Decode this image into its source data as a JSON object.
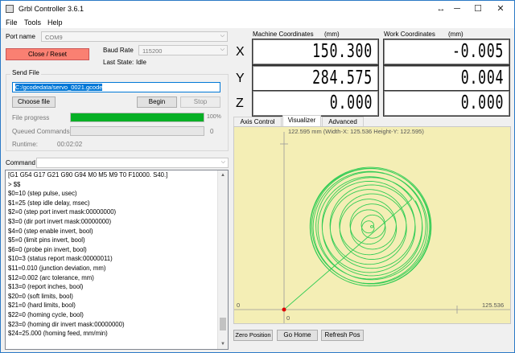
{
  "window": {
    "title": "Grbl Controller 3.6.1",
    "resize_glyph": "↔",
    "minimize_glyph": "─",
    "maximize_glyph": "☐",
    "close_glyph": "✕"
  },
  "menu": {
    "file": "File",
    "tools": "Tools",
    "help": "Help"
  },
  "connection": {
    "port_label": "Port name",
    "port_value": "COM9",
    "baud_label": "Baud Rate",
    "baud_value": "115200",
    "close_reset_label": "Close / Reset",
    "last_state_label": "Last State:",
    "last_state_value": "Idle"
  },
  "send_file": {
    "group_label": "Send File",
    "file_path": "C:/gcodedata/servo_0021.gcode",
    "choose_file_label": "Choose file",
    "begin_label": "Begin",
    "stop_label": "Stop",
    "progress_label": "File progress",
    "progress_fraction": 1.0,
    "progress_text": "100%",
    "queued_label": "Queued Commands",
    "queued_value": "0",
    "runtime_label": "Runtime:",
    "runtime_value": "00:02:02"
  },
  "command": {
    "label": "Command",
    "value": ""
  },
  "console": {
    "lines": [
      "[G1 G54 G17 G21 G90 G94 M0 M5 M9 T0 F10000. S40.]",
      "> $$",
      "$0=10 (step pulse, usec)",
      "$1=25 (step idle delay, msec)",
      "$2=0 (step port invert mask:00000000)",
      "$3=0 (dir port invert mask:00000000)",
      "$4=0 (step enable invert, bool)",
      "$5=0 (limit pins invert, bool)",
      "$6=0 (probe pin invert, bool)",
      "$10=3 (status report mask:00000011)",
      "$11=0.010 (junction deviation, mm)",
      "$12=0.002 (arc tolerance, mm)",
      "$13=0 (report inches, bool)",
      "$20=0 (soft limits, bool)",
      "$21=0 (hard limits, bool)",
      "$22=0 (homing cycle, bool)",
      "$23=0 (homing dir invert mask:00000000)",
      "$24=25.000 (homing feed, mm/min)"
    ],
    "scroll_fraction": 0.93
  },
  "coordinates": {
    "machine_label": "Machine Coordinates",
    "work_label": "Work Coordinates",
    "unit_label": "(mm)",
    "axes": [
      {
        "axis": "X",
        "machine": "150.300",
        "work": "-0.005"
      },
      {
        "axis": "Y",
        "machine": "284.575",
        "work": "0.004"
      },
      {
        "axis": "Z",
        "machine": "0.000",
        "work": "0.000"
      }
    ]
  },
  "tabs": {
    "axis_control": "Axis Control",
    "visualizer": "Visualizer",
    "advanced": "Advanced"
  },
  "visualizer": {
    "header_text": "122.595 mm  (Width-X: 125.536  Height-Y: 122.595)",
    "origin_label": "0",
    "x_end_label": "125.536",
    "y_zero_label": "0",
    "width_mm": 125.536,
    "height_mm": 122.595,
    "line_color": "#33cc55",
    "bg_color": "#f4eeb5",
    "tool_color": "#dd0000"
  },
  "bottom_buttons": {
    "zero_position": "Zero Position",
    "go_home": "Go Home",
    "refresh_pos": "Refresh Pos"
  }
}
